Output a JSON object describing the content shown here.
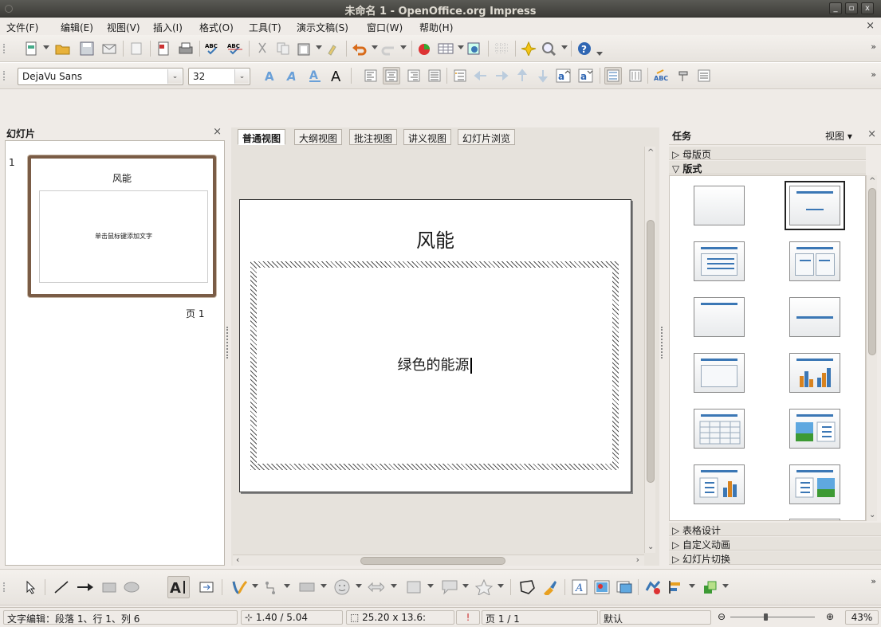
{
  "window": {
    "title": "未命名 1 - OpenOffice.org Impress",
    "min": "_",
    "max": "▫",
    "close": "x"
  },
  "menu": [
    "文件(F)",
    "编辑(E)",
    "视图(V)",
    "插入(I)",
    "格式(O)",
    "工具(T)",
    "演示文稿(S)",
    "窗口(W)",
    "帮助(H)"
  ],
  "menu_close": "×",
  "format": {
    "font_name": "DejaVu Sans",
    "font_size": "32"
  },
  "slides_pane": {
    "title": "幻灯片",
    "close": "×",
    "slide_number": "1",
    "thumb_title": "风能",
    "thumb_body": "单击鼠标键添加文字",
    "page_label": "页 1"
  },
  "view_tabs": [
    "普通视图",
    "大纲视图",
    "批注视图",
    "讲义视图",
    "幻灯片浏览"
  ],
  "slide": {
    "title": "风能",
    "body": "绿色的能源"
  },
  "tasks": {
    "title": "任务",
    "view_menu": "视图",
    "close": "×",
    "sections_top": [
      "母版页",
      "版式"
    ],
    "sections_bottom": [
      "表格设计",
      "自定义动画",
      "幻灯片切换"
    ]
  },
  "status": {
    "mode": "文字编辑：段落 1、行 1、列 6",
    "position": "1.40 / 5.04",
    "size": "25.20 x 13.6:",
    "page": "页 1 / 1",
    "layout": "默认",
    "zoom": "43%"
  },
  "colors": {
    "accent": "#3b77b5",
    "thumb_border": "#7a5c46"
  }
}
